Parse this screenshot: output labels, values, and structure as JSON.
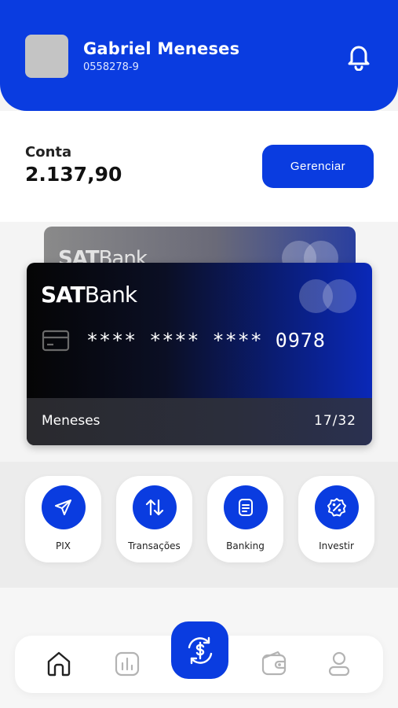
{
  "user": {
    "name": "Gabriel Meneses",
    "account": "0558278-9"
  },
  "balance": {
    "label": "Conta",
    "value": "2.137,90",
    "manage_label": "Gerenciar"
  },
  "card_back": {
    "brand_bold": "SAT",
    "brand_light": "Bank"
  },
  "card": {
    "brand_bold": "SAT",
    "brand_light": "Bank",
    "number": "**** **** **** 0978",
    "holder": "Meneses",
    "expiry": "17/32"
  },
  "actions": [
    {
      "label": "PIX",
      "icon": "send-icon"
    },
    {
      "label": "Transações",
      "icon": "transfer-arrows-icon"
    },
    {
      "label": "Banking",
      "icon": "document-icon"
    },
    {
      "label": "Investir",
      "icon": "percent-badge-icon"
    }
  ],
  "nav": [
    {
      "icon": "home-icon",
      "active": true
    },
    {
      "icon": "chart-icon",
      "active": false
    },
    {
      "icon": "exchange-dollar-icon",
      "active": false
    },
    {
      "icon": "wallet-icon",
      "active": false
    },
    {
      "icon": "profile-icon",
      "active": false
    }
  ],
  "colors": {
    "primary": "#0a3ce0",
    "background": "#f4f4f4"
  }
}
